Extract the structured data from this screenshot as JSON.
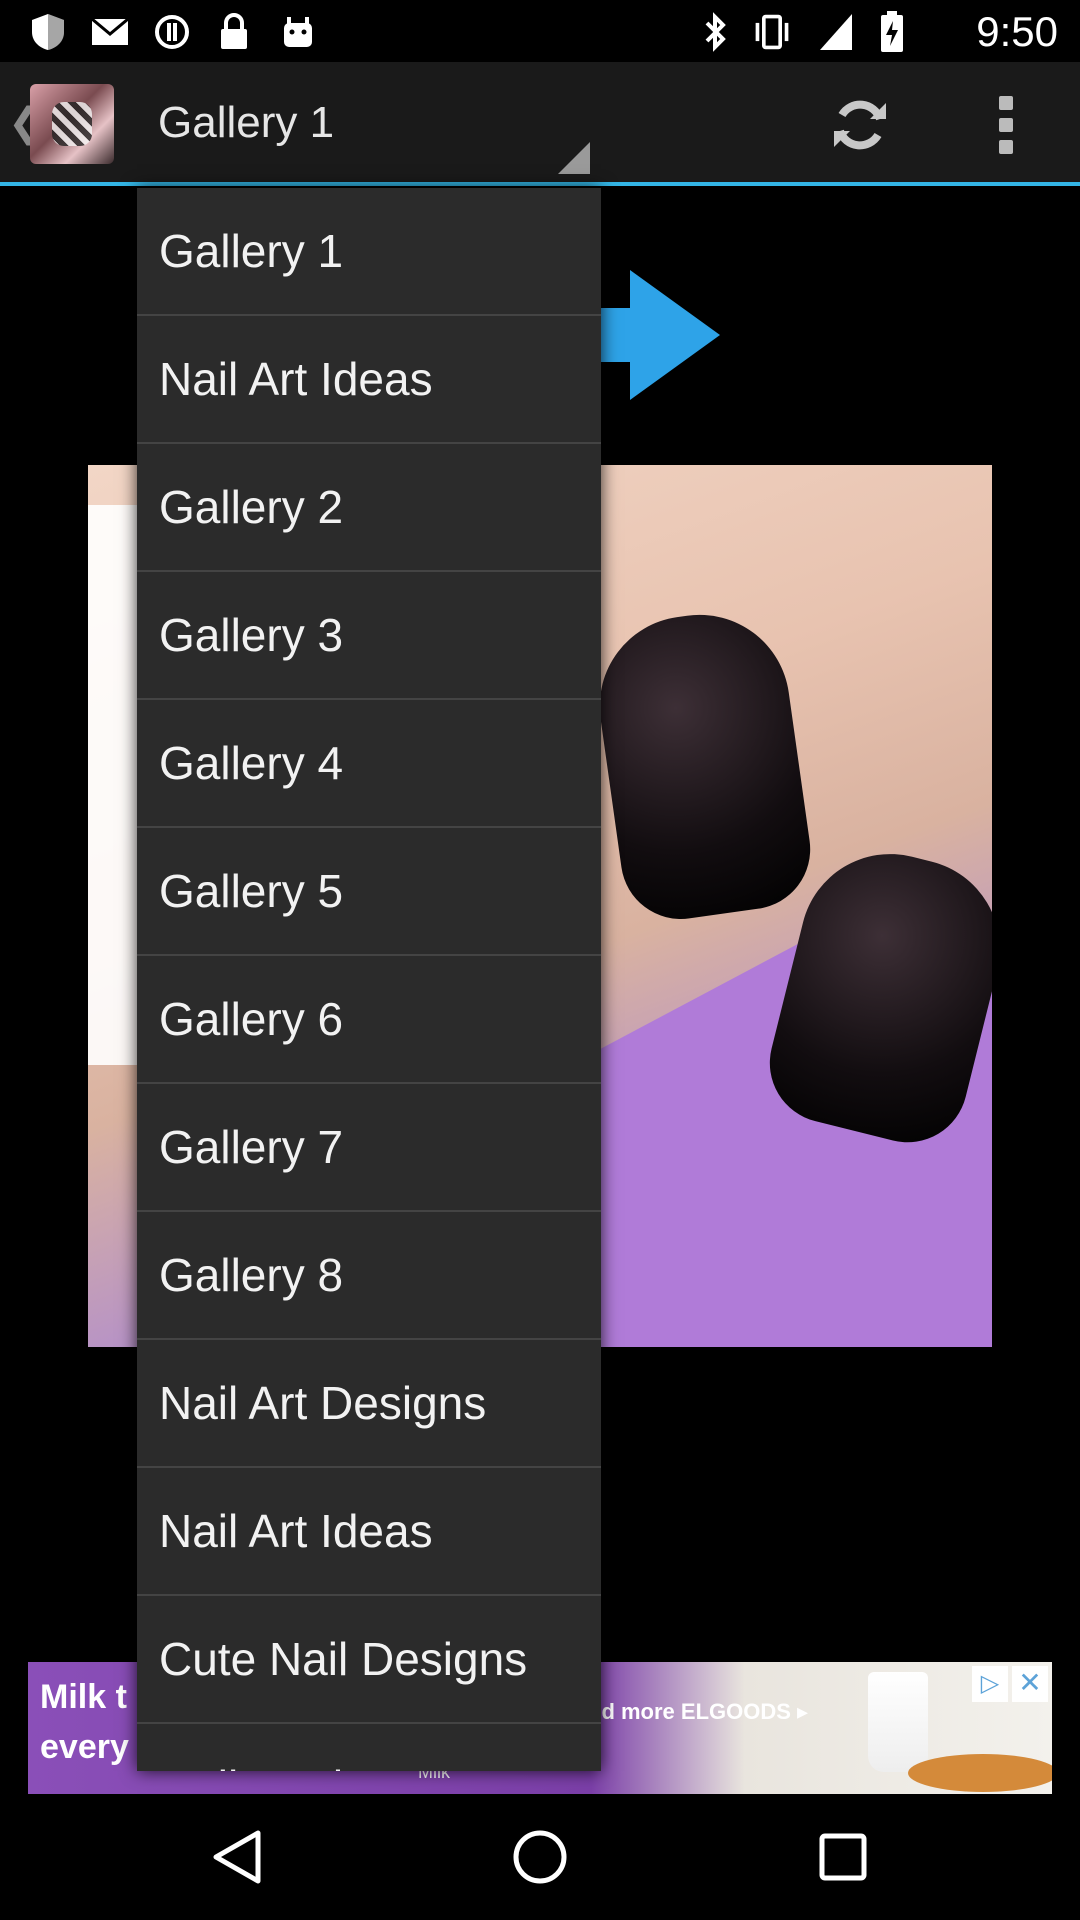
{
  "status_bar": {
    "time": "9:50",
    "left_icons": [
      "shield-icon",
      "mail-icon",
      "sync-circle-icon",
      "lock-icon",
      "android-icon"
    ],
    "right_icons": [
      "bluetooth-icon",
      "vibrate-icon",
      "signal-icon",
      "battery-icon"
    ]
  },
  "action_bar": {
    "spinner_title": "Gallery 1",
    "accent_color": "#33b5e5"
  },
  "dropdown": {
    "items": [
      "Gallery 1",
      "Nail Art Ideas",
      "Gallery 2",
      "Gallery 3",
      "Gallery 4",
      "Gallery 5",
      "Gallery 6",
      "Gallery 7",
      "Gallery 8",
      "Nail Art Designs",
      "Nail Art Ideas",
      "Cute Nail Designs",
      "Nail Desi"
    ]
  },
  "ad": {
    "left_text": "Milk t every",
    "mid_text": "nd more ELGOODS ▸",
    "brand_text": "Milk"
  },
  "nav_bar": {
    "buttons": [
      "back-icon",
      "home-icon",
      "recents-icon"
    ]
  }
}
